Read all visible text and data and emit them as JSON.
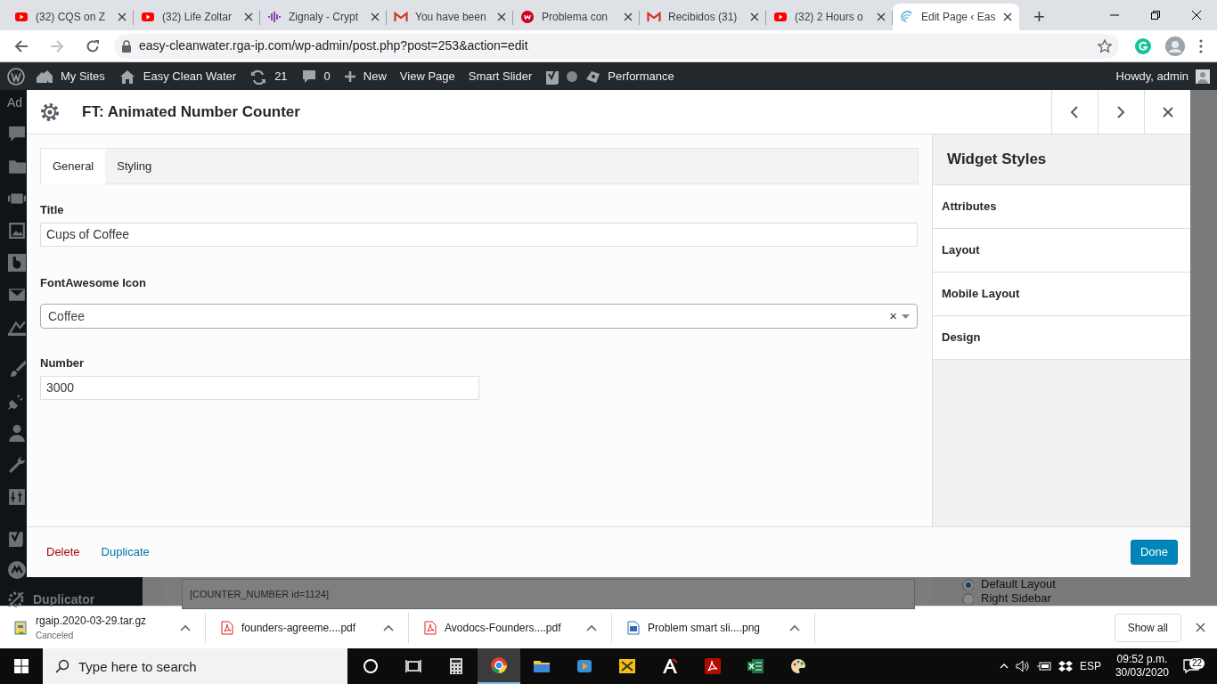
{
  "browser": {
    "tabs": [
      {
        "title": "(32) CQS on Z",
        "selected": false
      },
      {
        "title": "(32) Life Zoltar",
        "selected": false
      },
      {
        "title": "Zignaly - Crypt",
        "selected": false
      },
      {
        "title": "You have been",
        "selected": false
      },
      {
        "title": "Problema con",
        "selected": false
      },
      {
        "title": "Recibidos (31)",
        "selected": false
      },
      {
        "title": "(32) 2 Hours o",
        "selected": false
      },
      {
        "title": "Edit Page ‹ Eas",
        "selected": true
      }
    ],
    "new_tab": "+",
    "url": "easy-cleanwater.rga-ip.com/wp-admin/post.php?post=253&action=edit"
  },
  "admin_bar": {
    "items": [
      "My Sites",
      "Easy Clean Water",
      "21",
      "0",
      "New",
      "View Page",
      "Smart Slider",
      "Performance"
    ],
    "account": "Howdy, admin"
  },
  "background": {
    "sidebar_header": "Ad",
    "sidebar_item": "Duplicator",
    "shortcode": "[COUNTER_NUMBER id=1124]",
    "layout_options": [
      {
        "label": "Default Layout",
        "selected": true
      },
      {
        "label": "Right Sidebar",
        "selected": false
      }
    ]
  },
  "modal": {
    "title": "FT: Animated Number Counter",
    "tabs": [
      {
        "label": "General",
        "selected": true
      },
      {
        "label": "Styling",
        "selected": false
      }
    ],
    "fields": [
      {
        "kind": "text",
        "label": "Title",
        "value": "Cups of Coffee"
      },
      {
        "kind": "select",
        "label": "FontAwesome Icon",
        "value": "Coffee",
        "clear": "×"
      },
      {
        "kind": "short",
        "label": "Number",
        "value": "3000"
      }
    ],
    "side_title": "Widget Styles",
    "side_items": [
      "Attributes",
      "Layout",
      "Mobile Layout",
      "Design"
    ],
    "delete": "Delete",
    "duplicate": "Duplicate",
    "done": "Done"
  },
  "downloads": {
    "items": [
      {
        "name": "rgaip.2020-03-29.tar.gz",
        "status": "Canceled"
      },
      {
        "name": "founders-agreeme....pdf"
      },
      {
        "name": "Avodocs-Founders....pdf"
      },
      {
        "name": "Problem smart sli....png"
      }
    ],
    "show_all": "Show all"
  },
  "taskbar": {
    "search_placeholder": "Type here to search",
    "apps": [
      {
        "selected": false
      },
      {
        "selected": false
      },
      {
        "selected": false
      },
      {
        "selected": true
      },
      {
        "selected": false
      },
      {
        "selected": false
      },
      {
        "selected": false
      },
      {
        "selected": false
      },
      {
        "selected": false
      },
      {
        "selected": false
      },
      {
        "selected": false
      }
    ],
    "language": "ESP",
    "time": "09:52 p.m.",
    "date": "30/03/2020",
    "notifications": "22"
  }
}
